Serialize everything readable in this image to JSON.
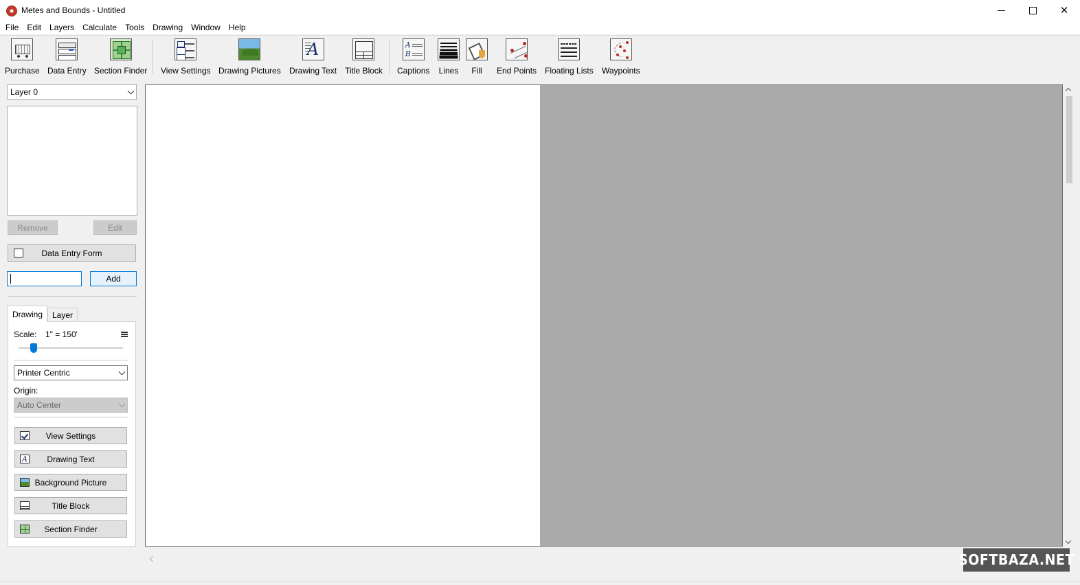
{
  "window": {
    "title": "Metes and Bounds - Untitled",
    "controls": {
      "minimize": "minimize",
      "maximize": "maximize",
      "close": "✕"
    }
  },
  "menu": [
    "File",
    "Edit",
    "Layers",
    "Calculate",
    "Tools",
    "Drawing",
    "Window",
    "Help"
  ],
  "toolbar": {
    "purchase": "Purchase",
    "data_entry": "Data Entry",
    "section_finder": "Section Finder",
    "view_settings": "View Settings",
    "drawing_pictures": "Drawing Pictures",
    "drawing_text": "Drawing Text",
    "title_block": "Title Block",
    "captions": "Captions",
    "lines": "Lines",
    "fill": "Fill",
    "end_points": "End Points",
    "floating_lists": "Floating Lists",
    "waypoints": "Waypoints"
  },
  "left_panel": {
    "layer_selected": "Layer 0",
    "remove_label": "Remove",
    "edit_label": "Edit",
    "data_entry_form_label": "Data Entry Form",
    "entry_value": "",
    "add_label": "Add",
    "tabs": {
      "drawing": "Drawing",
      "layer": "Layer"
    },
    "scale_label": "Scale:",
    "scale_value": "1\" = 150'",
    "scale_slider_fraction": 0.12,
    "centric_selected": "Printer Centric",
    "origin_label": "Origin:",
    "origin_selected": "Auto Center",
    "buttons": {
      "view_settings": "View Settings",
      "drawing_text": "Drawing Text",
      "background_picture": "Background Picture",
      "title_block": "Title Block",
      "section_finder": "Section Finder"
    }
  },
  "watermark": "SOFTBAZA.NET",
  "colors": {
    "canvas_background": "#aaaaaa",
    "page": "#ffffff",
    "accent": "#0078d7"
  }
}
